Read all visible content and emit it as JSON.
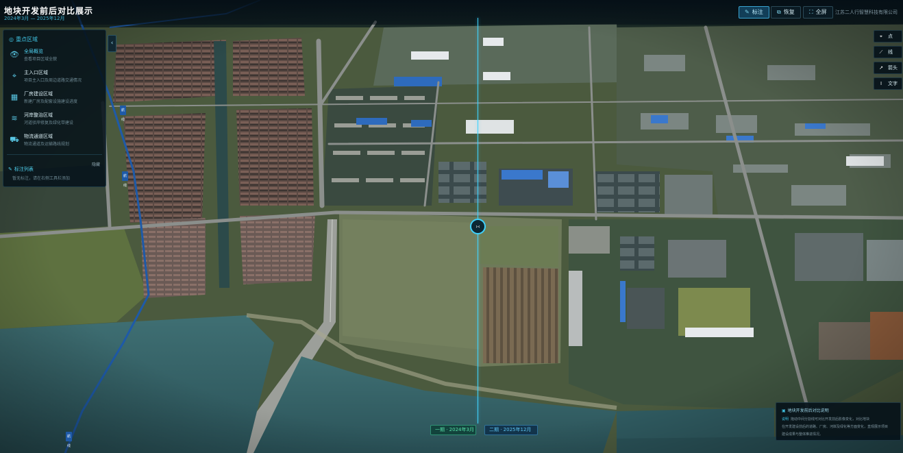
{
  "app": {
    "title": "地块开发前后对比展示",
    "subtitle": "2024年3月 — 2025年12月",
    "company": "江苏二人行智慧科技有限公司"
  },
  "toolbar": {
    "buttons": [
      {
        "label": "标注",
        "icon": "pencil-icon",
        "active": true
      },
      {
        "label": "恢复",
        "icon": "restore-icon",
        "active": false
      },
      {
        "label": "全屏",
        "icon": "fullscreen-icon",
        "active": false
      }
    ]
  },
  "sidebar": {
    "header": "重点区域",
    "items": [
      {
        "title": "全局概览",
        "desc": "查看项目区域全貌",
        "icon": "eye-icon",
        "selected": true
      },
      {
        "title": "主入口区域",
        "desc": "项目主入口及周边道路交通情况",
        "icon": "location-pin-icon",
        "selected": false
      },
      {
        "title": "厂房建设区域",
        "desc": "新建厂房及配套设施建设进度",
        "icon": "building-icon",
        "selected": false
      },
      {
        "title": "河岸整治区域",
        "desc": "河道驳岸修复及绿化带建设",
        "icon": "waves-icon",
        "selected": false
      },
      {
        "title": "物流通道区域",
        "desc": "物流通道及运输路线规划",
        "icon": "truck-icon",
        "selected": false
      }
    ],
    "section2": {
      "label": "标注列表",
      "hide_label": "隐藏",
      "empty_note": "暂无标注，请在右侧工具栏添加"
    }
  },
  "right_tools": [
    {
      "label": "点",
      "icon": "point-icon"
    },
    {
      "label": "线",
      "icon": "polyline-icon"
    },
    {
      "label": "箭头",
      "icon": "arrow-icon"
    },
    {
      "label": "文字",
      "icon": "text-icon"
    }
  ],
  "compare": {
    "period_before": "一期 · 2024年3月",
    "period_after": "二期 · 2025年12月",
    "handle_icon": "split-handle-icon"
  },
  "infobox": {
    "title": "地块开发前后对比说明",
    "lines": [
      {
        "tag": "说明",
        "text": "拖动中间分割线可对比开发前后影像变化，对比地块"
      },
      {
        "tag": "",
        "text": "在开发建设前后的道路、厂房、河岸及绿化等方面变化，直观展示项目"
      },
      {
        "tag": "",
        "text": "建设成果与整体推进情况。"
      }
    ]
  },
  "route": {
    "tag_text": "航线"
  },
  "colors": {
    "accent": "#3fd3ff",
    "panel_bg": "#06121a",
    "route": "#1e5aa8",
    "before_label": "#58e0a8",
    "after_label": "#5cc3f0"
  }
}
